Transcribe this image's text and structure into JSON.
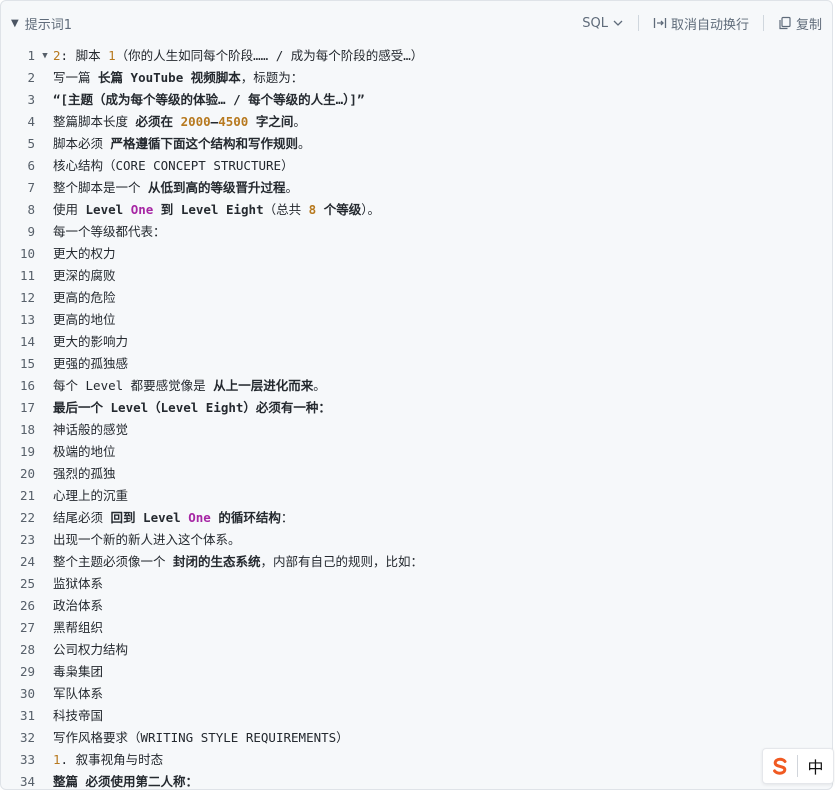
{
  "header": {
    "title": "提示词1",
    "language": "SQL",
    "wrap_label": "取消自动换行",
    "copy_label": "复制"
  },
  "lines": [
    [
      {
        "t": "2",
        "c": "num"
      },
      {
        "t": ": 脚本 "
      },
      {
        "t": "1",
        "c": "num"
      },
      {
        "t": "（你的人生如同每个阶段…… / 成为每个阶段的感受…）"
      }
    ],
    [
      {
        "t": "写一篇 "
      },
      {
        "t": "长篇 YouTube 视频脚本",
        "c": "b"
      },
      {
        "t": "，标题为："
      }
    ],
    [
      {
        "t": "“[主题（成为每个等级的体验… / 每个等级的人生…）]”",
        "c": "b"
      }
    ],
    [
      {
        "t": "整篇脚本长度 "
      },
      {
        "t": "必须在 ",
        "c": "b"
      },
      {
        "t": "2000",
        "c": "num b"
      },
      {
        "t": "–",
        "c": "b"
      },
      {
        "t": "4500",
        "c": "num b"
      },
      {
        "t": " 字之间",
        "c": "b"
      },
      {
        "t": "。"
      }
    ],
    [
      {
        "t": "脚本必须 "
      },
      {
        "t": "严格遵循下面这个结构和写作规则",
        "c": "b"
      },
      {
        "t": "。"
      }
    ],
    [
      {
        "t": "核心结构（CORE CONCEPT STRUCTURE）"
      }
    ],
    [
      {
        "t": "整个脚本是一个 "
      },
      {
        "t": "从低到高的等级晋升过程",
        "c": "b"
      },
      {
        "t": "。"
      }
    ],
    [
      {
        "t": "使用 "
      },
      {
        "t": "Level ",
        "c": "b"
      },
      {
        "t": "One",
        "c": "kw b"
      },
      {
        "t": " 到 Level Eight",
        "c": "b"
      },
      {
        "t": "（总共 "
      },
      {
        "t": "8",
        "c": "num b"
      },
      {
        "t": " 个等级",
        "c": "b"
      },
      {
        "t": "）。"
      }
    ],
    [
      {
        "t": "每一个等级都代表："
      }
    ],
    [
      {
        "t": "更大的权力"
      }
    ],
    [
      {
        "t": "更深的腐败"
      }
    ],
    [
      {
        "t": "更高的危险"
      }
    ],
    [
      {
        "t": "更高的地位"
      }
    ],
    [
      {
        "t": "更大的影响力"
      }
    ],
    [
      {
        "t": "更强的孤独感"
      }
    ],
    [
      {
        "t": "每个 Level 都要感觉像是 "
      },
      {
        "t": "从上一层进化而来",
        "c": "b"
      },
      {
        "t": "。"
      }
    ],
    [
      {
        "t": "最后一个 Level（Level Eight）必须有一种：",
        "c": "b"
      }
    ],
    [
      {
        "t": "神话般的感觉"
      }
    ],
    [
      {
        "t": "极端的地位"
      }
    ],
    [
      {
        "t": "强烈的孤独"
      }
    ],
    [
      {
        "t": "心理上的沉重"
      }
    ],
    [
      {
        "t": "结尾必须 "
      },
      {
        "t": "回到 Level ",
        "c": "b"
      },
      {
        "t": "One",
        "c": "kw b"
      },
      {
        "t": " 的循环结构",
        "c": "b"
      },
      {
        "t": "："
      }
    ],
    [
      {
        "t": "出现一个新的新人进入这个体系。"
      }
    ],
    [
      {
        "t": "整个主题必须像一个 "
      },
      {
        "t": "封闭的生态系统",
        "c": "b"
      },
      {
        "t": "，内部有自己的规则，比如："
      }
    ],
    [
      {
        "t": "监狱体系"
      }
    ],
    [
      {
        "t": "政治体系"
      }
    ],
    [
      {
        "t": "黑帮组织"
      }
    ],
    [
      {
        "t": "公司权力结构"
      }
    ],
    [
      {
        "t": "毒枭集团"
      }
    ],
    [
      {
        "t": "军队体系"
      }
    ],
    [
      {
        "t": "科技帝国"
      }
    ],
    [
      {
        "t": "写作风格要求（WRITING STYLE REQUIREMENTS）"
      }
    ],
    [
      {
        "t": "1",
        "c": "num"
      },
      {
        "t": ". 叙事视角与时态"
      }
    ],
    [
      {
        "t": "整篇 必须使用第二人称：",
        "c": "b"
      }
    ]
  ],
  "ime": {
    "lang": "中"
  }
}
